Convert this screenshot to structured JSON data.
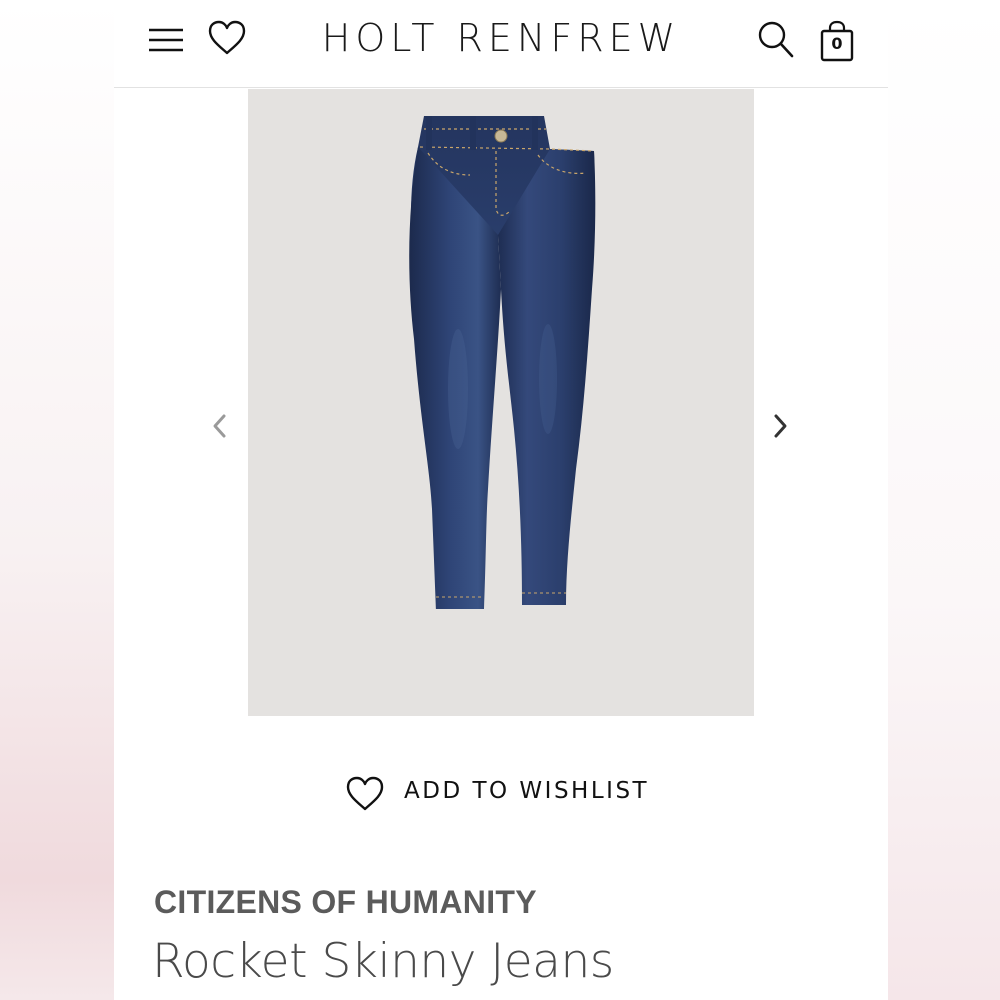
{
  "header": {
    "brand": "HOLT RENFREW",
    "bag_count": "0",
    "icons": [
      "menu-icon",
      "heart-icon",
      "search-icon",
      "shopping-bag-icon"
    ]
  },
  "gallery": {
    "image_subject": "dark wash skinny jeans",
    "background_color": "#e4e2e0",
    "icons": [
      "chevron-left-icon",
      "chevron-right-icon"
    ]
  },
  "wishlist": {
    "label": "ADD TO WISHLIST",
    "icon": "heart-icon"
  },
  "product": {
    "designer": "CITIZENS OF HUMANITY",
    "name": "Rocket Skinny Jeans"
  },
  "colors": {
    "denim_dark": "#1f2f55",
    "denim_light": "#3b5282",
    "text_dark": "#111111",
    "text_gray": "#5b5b5b"
  }
}
